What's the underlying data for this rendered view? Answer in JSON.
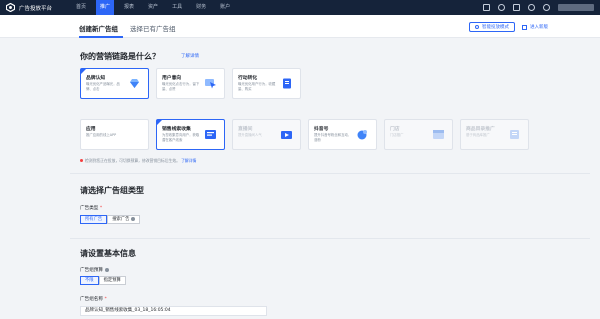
{
  "topbar": {
    "brand": "广告投放平台",
    "nav": [
      "首页",
      "推广",
      "报表",
      "资产",
      "工具",
      "财务",
      "账户"
    ]
  },
  "subheader": {
    "tab_create": "创建新广告组",
    "tab_existing": "选择已有广告组",
    "smart_button": "智能投放模式",
    "new_button": "进入新版"
  },
  "marketing": {
    "title": "你的营销链路是什么？",
    "help": "了解详情",
    "cards_row1": [
      {
        "title": "品牌认知",
        "desc": "曝光优化产品曝光，品牌、点击"
      },
      {
        "title": "用户意向",
        "desc": "曝光优化点击行为，留下量、点赞"
      },
      {
        "title": "行动转化",
        "desc": "曝光优化用户行为，收藏量、购买"
      }
    ],
    "cards_row2": [
      {
        "title": "应用",
        "desc": "推广应用的线上APP"
      },
      {
        "title": "销售线索收集",
        "desc": "为您收集意向用户，获取潜在客户线索"
      },
      {
        "title": "直播间",
        "desc": "提升直播间人气"
      },
      {
        "title": "抖音号",
        "desc": "提升抖音号粉丝和互动，涨粉"
      },
      {
        "title": "门店",
        "desc": "门店推广"
      },
      {
        "title": "商品目录推广",
        "desc": "基于商品库推广"
      }
    ],
    "warning": "检测到您正在投放，可切换预算，修改营销目标后生效。",
    "warning_link": "了解详情"
  },
  "adtype": {
    "title": "请选择广告组类型",
    "label": "广告类型",
    "options": [
      "所有广告",
      "搜索广告"
    ]
  },
  "basic": {
    "title": "请设置基本信息",
    "budget_label": "广告组预算",
    "budget_options": [
      "不限",
      "指定预算"
    ],
    "name_label": "广告组名称",
    "name_value": "品牌认知_销售线索收集_03_18_16:05:04"
  }
}
